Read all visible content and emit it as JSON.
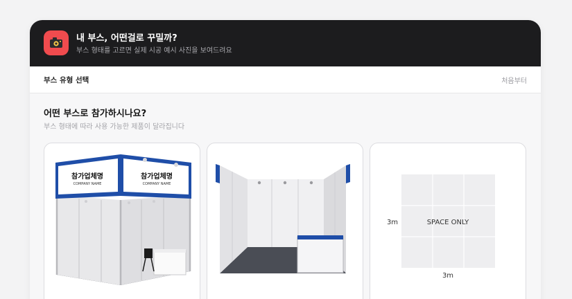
{
  "header": {
    "icon": "camera-icon",
    "title": "내 부스, 어떤걸로 꾸밀까?",
    "subtitle": "부스 형태를 고르면 실제 시공 예시 사진을 보여드려요"
  },
  "stepbar": {
    "step_label": "부스 유형 선택",
    "restart_label": "처음부터"
  },
  "question": {
    "title": "어떤 부스로 참가하시나요?",
    "hint": "부스 형태에 따라 사용 가능한 제품이 달라집니다"
  },
  "options": [
    {
      "name": "corner-booth",
      "fascia_text": "참가업체명",
      "fascia_subtext": "COMPANY NAME"
    },
    {
      "name": "inline-booth"
    },
    {
      "name": "space-only",
      "center_label": "SPACE ONLY",
      "width_label": "3m",
      "depth_label": "3m"
    }
  ],
  "colors": {
    "header_bg": "#1c1c1e",
    "accent_red": "#f04b4e",
    "fascia_blue": "#1f4ea8"
  }
}
